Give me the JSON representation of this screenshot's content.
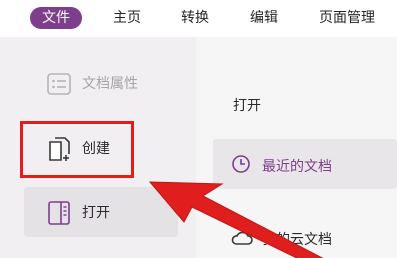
{
  "menubar": {
    "items": [
      {
        "label": "文件",
        "active": true
      },
      {
        "label": "主页"
      },
      {
        "label": "转换"
      },
      {
        "label": "编辑"
      },
      {
        "label": "页面管理"
      }
    ]
  },
  "sidebar": {
    "items": [
      {
        "label": "文档属性",
        "icon": "document-properties-icon",
        "state": "disabled"
      },
      {
        "label": "创建",
        "icon": "create-document-icon",
        "state": "highlighted"
      },
      {
        "label": "打开",
        "icon": "open-document-icon",
        "state": "selected"
      }
    ]
  },
  "content": {
    "title": "打开",
    "items": [
      {
        "label": "最近的文档",
        "icon": "clock-icon"
      },
      {
        "label": "我的云文档",
        "icon": "cloud-icon"
      }
    ]
  },
  "colors": {
    "accent": "#7d3e8c",
    "annotation": "#e01e1e"
  }
}
